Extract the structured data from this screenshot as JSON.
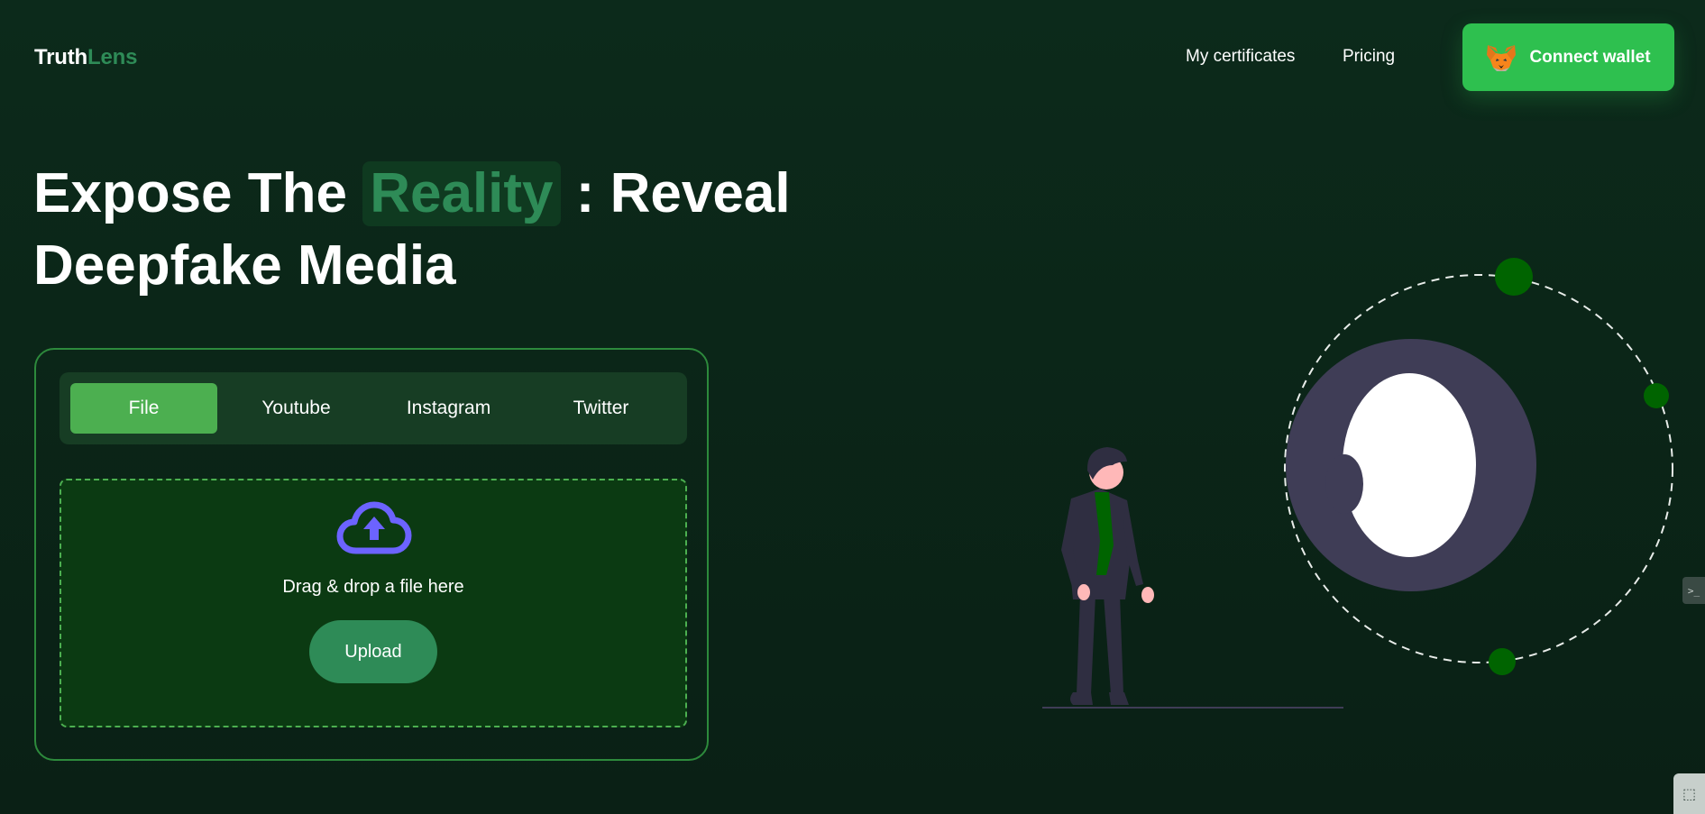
{
  "header": {
    "logo_part1": "Truth",
    "logo_part2": "Lens",
    "nav": {
      "certificates": "My certificates",
      "pricing": "Pricing"
    },
    "connect_wallet": "Connect wallet",
    "wallet_icon": "metamask-fox-icon"
  },
  "hero": {
    "title_part1": "Expose The ",
    "title_highlight": "Reality",
    "title_part2": " : Reveal",
    "title_line2": "Deepfake Media"
  },
  "uploader": {
    "tabs": [
      {
        "label": "File",
        "active": true
      },
      {
        "label": "Youtube",
        "active": false
      },
      {
        "label": "Instagram",
        "active": false
      },
      {
        "label": "Twitter",
        "active": false
      }
    ],
    "drop_text": "Drag & drop a file here",
    "upload_label": "Upload",
    "upload_icon": "cloud-upload-icon"
  },
  "colors": {
    "accent": "#2ec04f",
    "brand_green": "#2e8b57",
    "tab_active": "#4caf50",
    "background": "#0b2618",
    "cloud_icon": "#6c63ff"
  }
}
